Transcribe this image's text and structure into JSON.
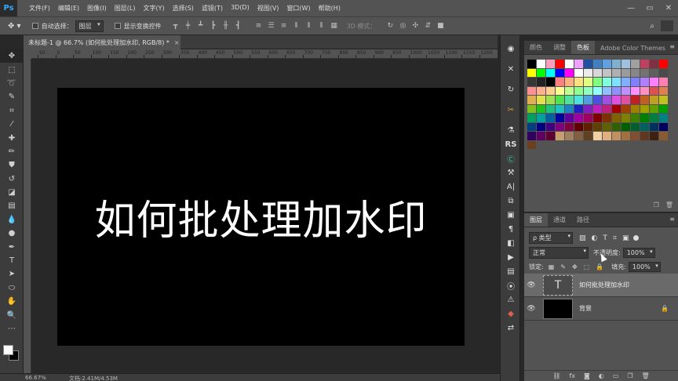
{
  "app": {
    "logo": "Ps"
  },
  "menu": [
    "文件(F)",
    "编辑(E)",
    "图像(I)",
    "图层(L)",
    "文字(Y)",
    "选择(S)",
    "滤镜(T)",
    "3D(D)",
    "视图(V)",
    "窗口(W)",
    "帮助(H)"
  ],
  "window_controls": {
    "minimize": "—",
    "maximize": "▭",
    "close": "✕"
  },
  "options_bar": {
    "auto_select_label": "自动选择：",
    "auto_select_value": "图层",
    "show_transform_label": "显示变换控件",
    "mode_3d_label": "3D 模式："
  },
  "document_tab": {
    "title": "未标题-1 @ 66.7% (如何批处理加水印, RGB/8) *",
    "close": "×"
  },
  "ruler_labels": [
    "50",
    "0",
    "50",
    "100",
    "150",
    "200",
    "250",
    "300",
    "350",
    "400",
    "450",
    "500",
    "550",
    "600",
    "650",
    "700",
    "750",
    "800",
    "850",
    "900",
    "950",
    "1000",
    "1050",
    "1100",
    "1150",
    "1200"
  ],
  "canvas": {
    "text": "如何批处理加水印",
    "background": "#000000",
    "text_color": "#ffffff"
  },
  "status": {
    "zoom": "66.67%",
    "doc": "文档:2.41M/4.53M"
  },
  "swatches_panel": {
    "tabs": [
      "颜色",
      "调整",
      "色板",
      "Adobe Color Themes"
    ],
    "active_tab": 2
  },
  "swatches": [
    "#000000",
    "#ffffff",
    "#ff9dbe",
    "#ff0000",
    "#ffffff",
    "#f0a0ff",
    "#2050a0",
    "#4080c0",
    "#60a0e0",
    "#80b0d0",
    "#a0c0e0",
    "#a0a0a0",
    "#c04060",
    "#803040",
    "#ff0000",
    "#ffff00",
    "#00ff00",
    "#00ffff",
    "#0000ff",
    "#ff00ff",
    "#ffffff",
    "#ebebeb",
    "#d7d7d7",
    "#c3c3c3",
    "#afafaf",
    "#9b9b9b",
    "#878787",
    "#737373",
    "#5f5f5f",
    "#4b4b4b",
    "#373737",
    "#232323",
    "#000000",
    "#ff8080",
    "#ffb080",
    "#ffe080",
    "#e0ff80",
    "#80ff80",
    "#80ffe0",
    "#80e0ff",
    "#80b0ff",
    "#8080ff",
    "#b080ff",
    "#ff80ff",
    "#ff80b0",
    "#ff9090",
    "#ffb090",
    "#ffd090",
    "#ffff90",
    "#c0ff90",
    "#90ff90",
    "#90ffc0",
    "#90ffff",
    "#90c0ff",
    "#9090ff",
    "#c090ff",
    "#ff90ff",
    "#ff90c0",
    "#e05050",
    "#e08050",
    "#e0b050",
    "#e0e050",
    "#a0e050",
    "#50e050",
    "#50e0a0",
    "#50e0e0",
    "#50a0e0",
    "#5050e0",
    "#a050e0",
    "#e050e0",
    "#e050a0",
    "#c02020",
    "#c06020",
    "#c0a020",
    "#c0c020",
    "#80c020",
    "#20c020",
    "#20c080",
    "#20c0c0",
    "#2080c0",
    "#2020c0",
    "#8020c0",
    "#c020c0",
    "#c02080",
    "#a00000",
    "#a04000",
    "#a08000",
    "#a0a000",
    "#60a000",
    "#00a000",
    "#00a060",
    "#00a0a0",
    "#0060a0",
    "#0000a0",
    "#6000a0",
    "#a000a0",
    "#a00060",
    "#800000",
    "#803000",
    "#806000",
    "#808000",
    "#408000",
    "#008000",
    "#008040",
    "#008080",
    "#004080",
    "#000080",
    "#400080",
    "#800080",
    "#800040",
    "#600000",
    "#602000",
    "#604000",
    "#606000",
    "#306000",
    "#006000",
    "#006030",
    "#006060",
    "#003060",
    "#000060",
    "#300060",
    "#600060",
    "#600030",
    "#c8a070",
    "#a08060",
    "#806040",
    "#604020",
    "#f0d0a0",
    "#e0b080",
    "#c09060",
    "#a07040",
    "#805030",
    "#603820",
    "#402010",
    "#8a5a30",
    "#6a4020"
  ],
  "layers_panel": {
    "tabs": [
      "图层",
      "通道",
      "路径"
    ],
    "active_tab": 0,
    "filter_label": "ρ 类型",
    "blend_mode": "正常",
    "opacity_label": "不透明度:",
    "opacity_value": "100%",
    "lock_label": "锁定:",
    "fill_label": "填充:",
    "fill_value": "100%",
    "layers": [
      {
        "name": "如何批处理加水印",
        "type": "text",
        "thumb_glyph": "T",
        "selected": true
      },
      {
        "name": "背景",
        "type": "background",
        "thumb_glyph": "",
        "selected": false
      }
    ]
  }
}
